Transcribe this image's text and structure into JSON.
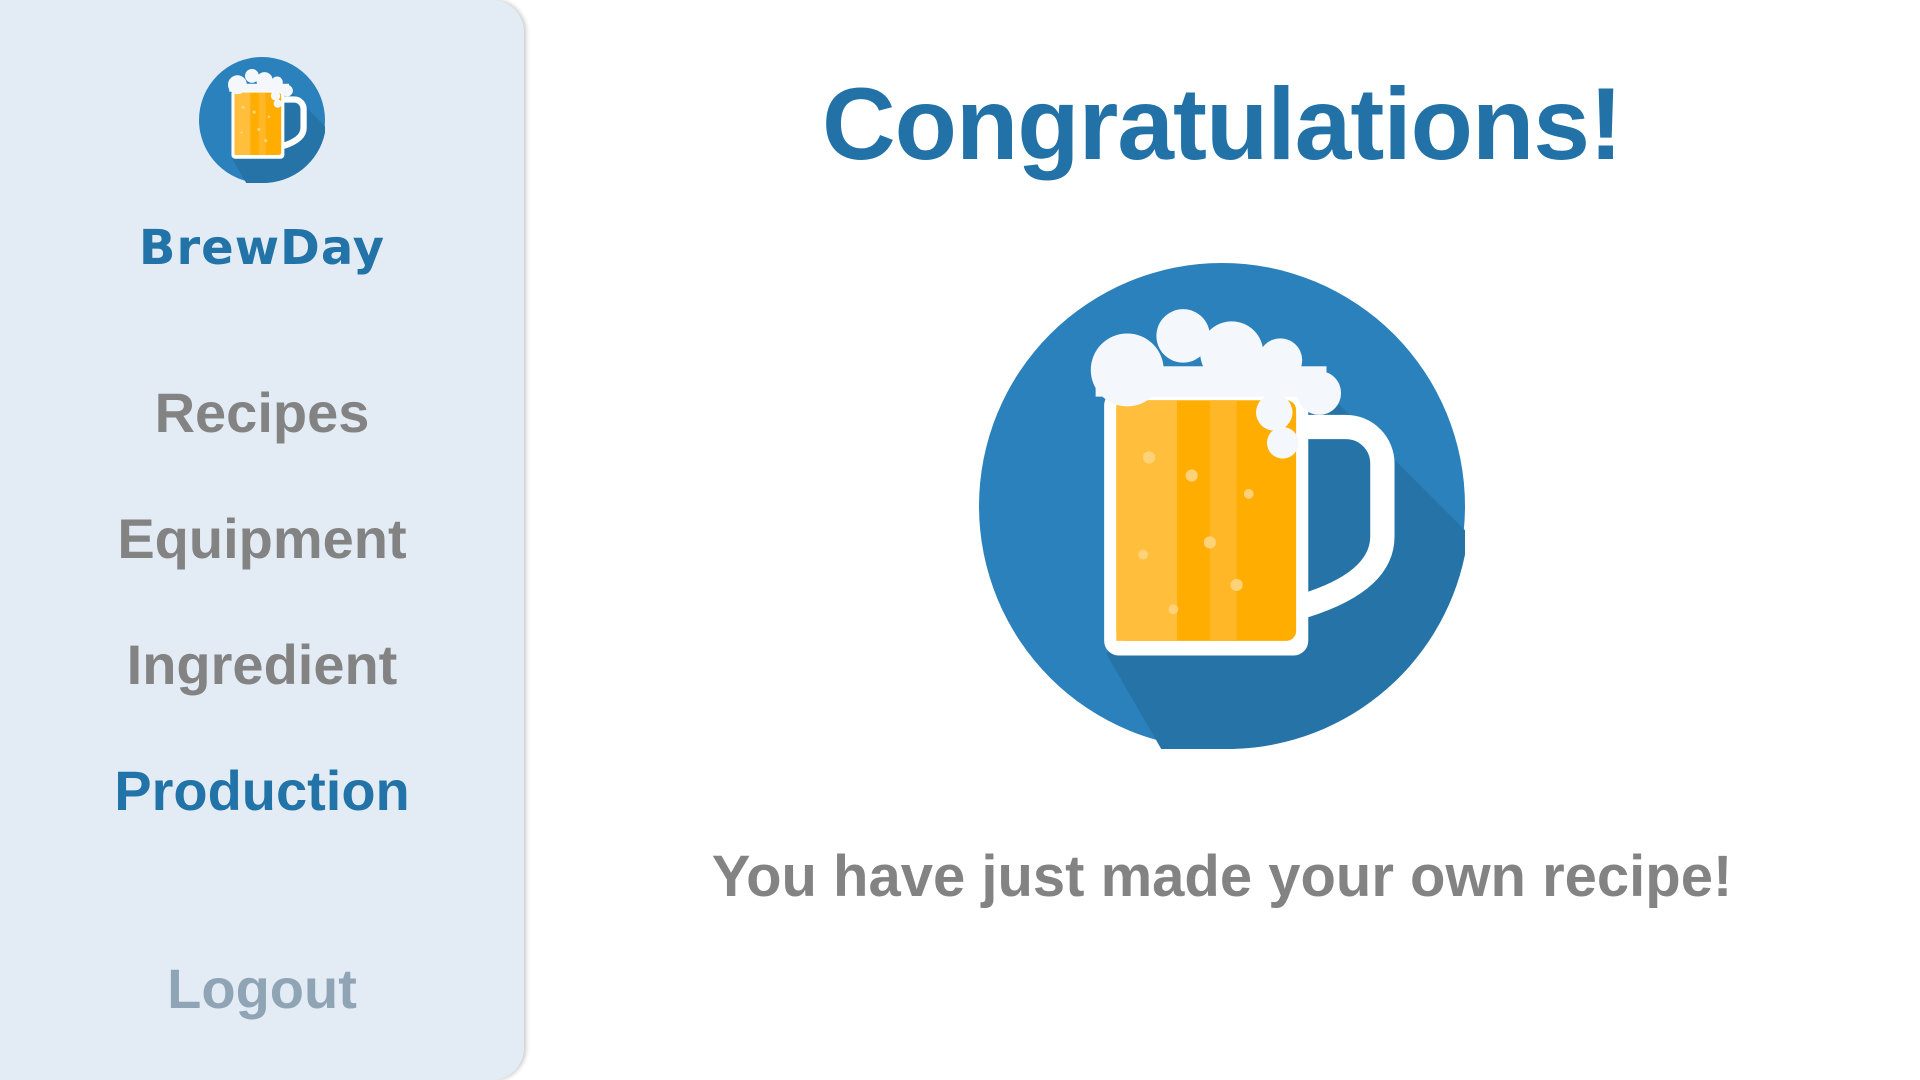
{
  "sidebar": {
    "logo_icon": "beer-mug-icon",
    "brand": "BrewDay",
    "nav": [
      {
        "label": "Recipes",
        "active": false
      },
      {
        "label": "Equipment",
        "active": false
      },
      {
        "label": "Ingredient",
        "active": false
      },
      {
        "label": "Production",
        "active": true
      }
    ],
    "logout_label": "Logout"
  },
  "main": {
    "title": "Congratulations!",
    "hero_icon": "beer-mug-icon",
    "message": "You have just made your own recipe!"
  },
  "colors": {
    "accent": "#2272a8",
    "sidebar_bg": "#e3ecf4",
    "muted_text": "#838383",
    "logout_text": "#8fa4b4",
    "circle_blue": "#2b81bb",
    "beer_orange": "#ffad00"
  }
}
